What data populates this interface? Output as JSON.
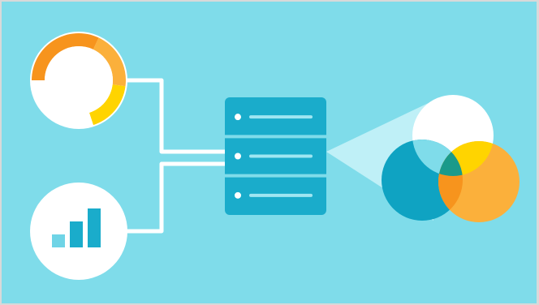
{
  "illustration": {
    "colors": {
      "background": "#7fdcea",
      "white": "#ffffff",
      "teal": "#1aaccb",
      "teal_dark": "#0b9dbb",
      "teal_light": "#6fd4e6",
      "orange": "#f7941d",
      "orange_light": "#fbb03b",
      "yellow": "#ffd400",
      "line_light": "#9fe6f2",
      "beam": "#bff0f7"
    },
    "icons": {
      "gauge": "donut-gauge-icon",
      "bar_chart": "bar-chart-icon",
      "server": "server-stack-icon",
      "venn": "venn-diagram-icon"
    },
    "gauge": {
      "segments": [
        {
          "color": "#f7941d",
          "fraction": 0.32
        },
        {
          "color": "#fbb03b",
          "fraction": 0.2
        },
        {
          "color": "#ffd400",
          "fraction": 0.18
        },
        {
          "color": "#ffffff",
          "fraction": 0.3
        }
      ]
    },
    "bar_chart": {
      "bars": [
        {
          "value": 1,
          "color": "#6fd4e6"
        },
        {
          "value": 2,
          "color": "#1aaccb"
        },
        {
          "value": 3,
          "color": "#1aaccb"
        }
      ]
    },
    "server": {
      "units": 3
    },
    "venn": {
      "sets": 3
    }
  }
}
